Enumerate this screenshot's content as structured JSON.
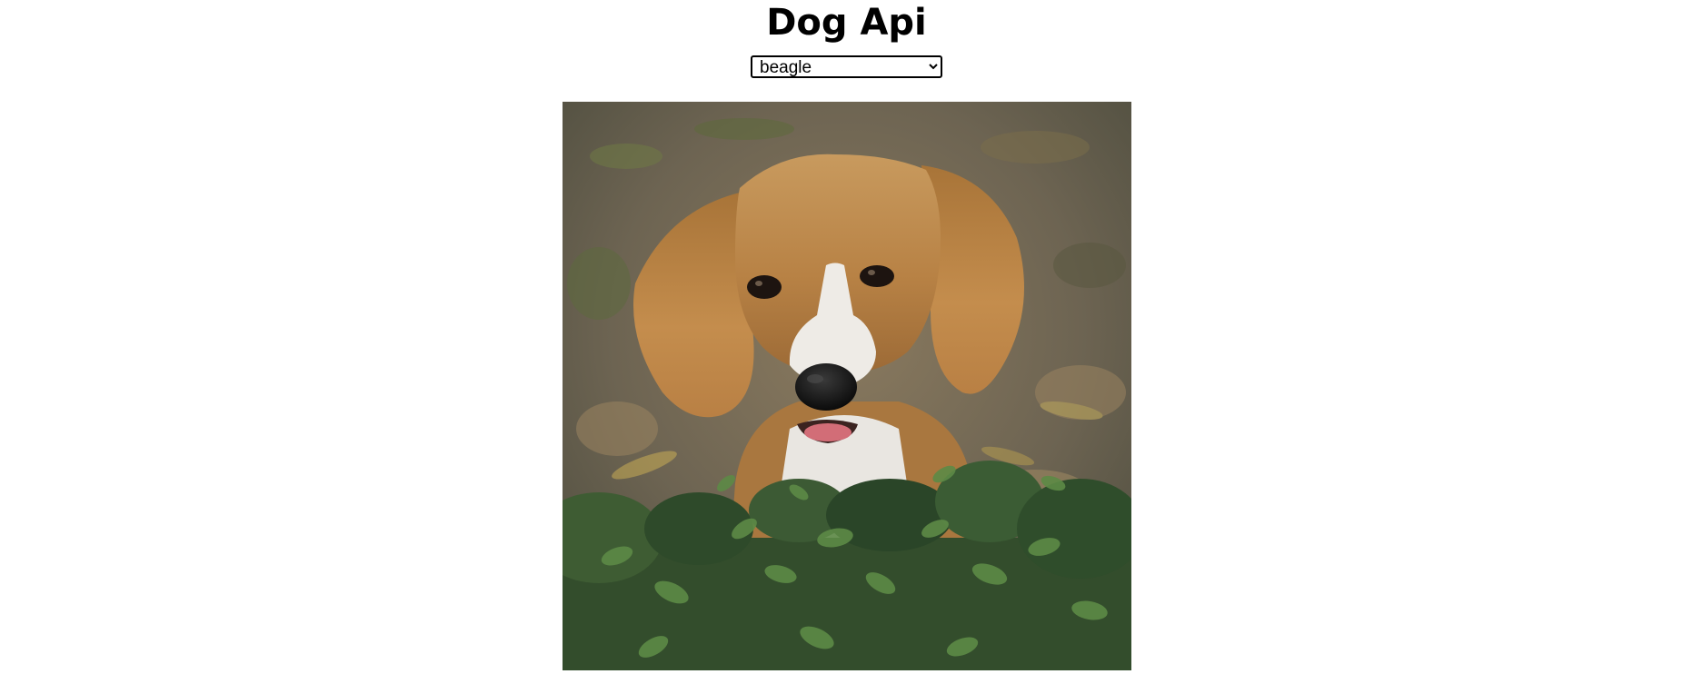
{
  "page": {
    "title": "Dog Api"
  },
  "breed_select": {
    "selected": "beagle",
    "options": [
      "beagle"
    ]
  },
  "photo": {
    "subject": "beagle"
  },
  "colors": {
    "background": "#ffffff",
    "text": "#000000"
  }
}
